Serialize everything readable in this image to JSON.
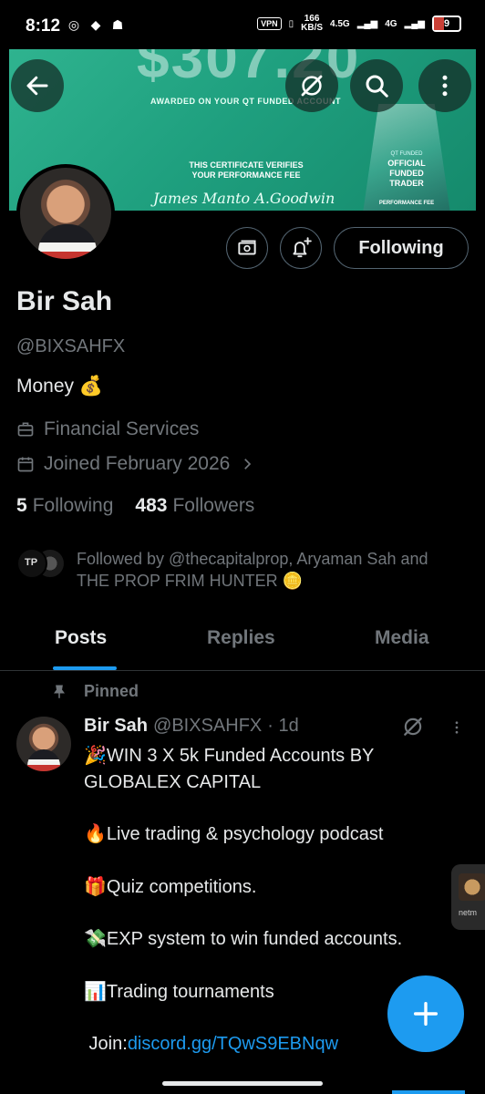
{
  "status_bar": {
    "time": "8:12",
    "vpn": "VPN",
    "speed": "166",
    "speed_unit": "KB/S",
    "net1": "4.5G",
    "net2": "4G",
    "battery": "9"
  },
  "banner": {
    "amount": "$307.20",
    "awarded": "AWARDED ON YOUR QT FUNDED ACCOUNT",
    "certificate": "THIS CERTIFICATE VERIFIES YOUR PERFORMANCE FEE",
    "signatures": "James Manto  A.Goodwin",
    "trophy_brand": "QT FUNDED",
    "trophy_text": "OFFICIAL FUNDED TRADER",
    "trophy_fee": "PERFORMANCE FEE",
    "bg_color": "#1fa07f"
  },
  "profile": {
    "name": "Bir Sah",
    "handle": "@BIXSAHFX",
    "bio": "Money 💰",
    "category": "Financial Services",
    "joined": "Joined February 2026",
    "following_count": "5",
    "following_label": "Following",
    "followers_count": "483",
    "followers_label": "Followers",
    "followed_by": "Followed by @thecapitalprop, Aryaman Sah and THE PROP FRIM HUNTER 🪙",
    "follow_button": "Following"
  },
  "tabs": [
    {
      "label": "Posts",
      "active": true
    },
    {
      "label": "Replies",
      "active": false
    },
    {
      "label": "Media",
      "active": false
    }
  ],
  "pinned_post": {
    "pinned_label": "Pinned",
    "author_name": "Bir Sah",
    "author_handle": "@BIXSAHFX",
    "time": "· 1d",
    "lines": [
      "🎉WIN 3 X 5k Funded Accounts BY GLOBALEX CAPITAL",
      "🔥Live trading & psychology podcast",
      "🎁Quiz competitions.",
      "💸EXP system to win funded accounts.",
      "📊Trading tournaments"
    ],
    "join_prefix": " Join:",
    "join_link": "discord.gg/TQwS9EBNqw"
  },
  "side_thumb_label": "netm",
  "accent_color": "#1d9bf0"
}
